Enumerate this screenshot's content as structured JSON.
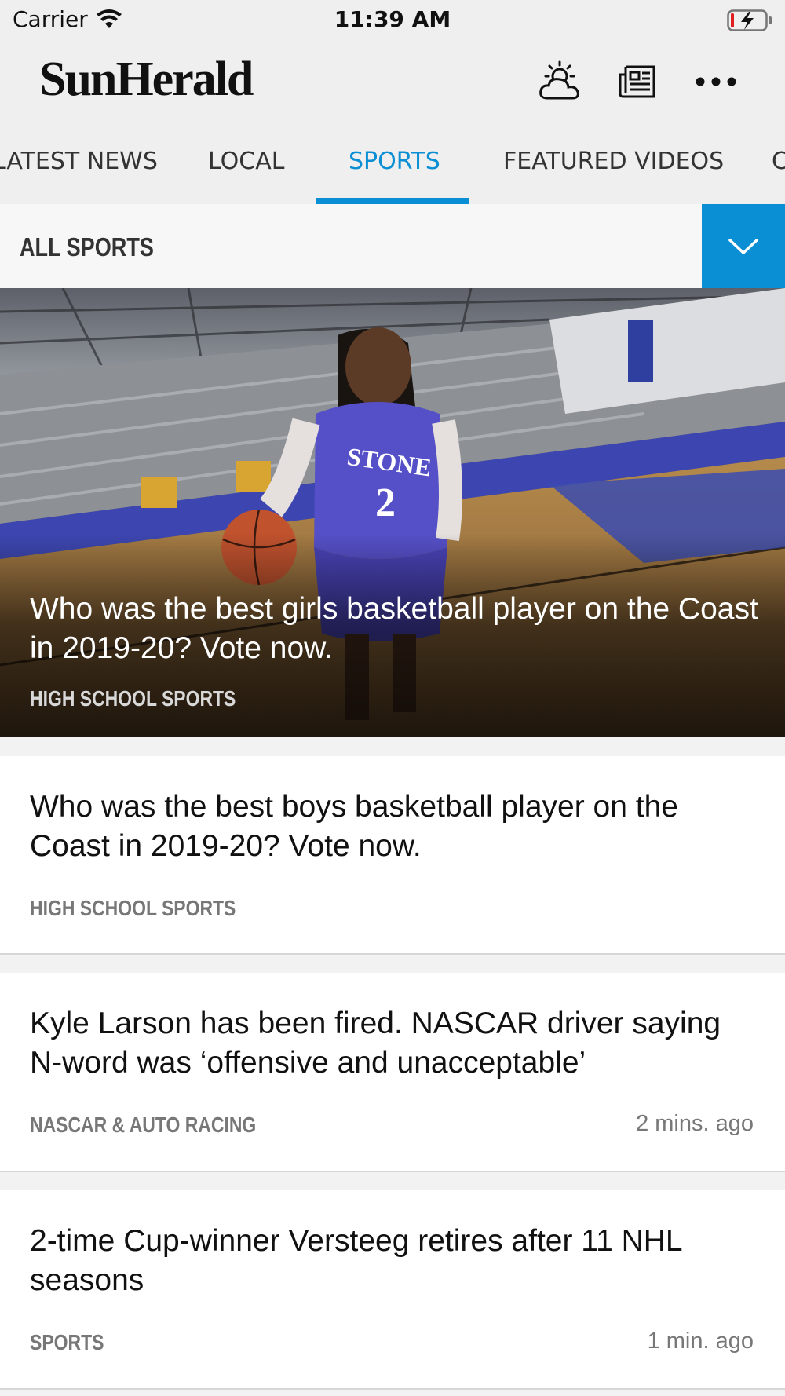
{
  "status_bar": {
    "carrier": "Carrier",
    "time": "11:39 AM"
  },
  "header": {
    "brand": "SunHeraId",
    "icons": [
      "weather-icon",
      "e-edition-icon",
      "more-icon"
    ]
  },
  "tabs": [
    {
      "label": "LATEST NEWS",
      "active": false
    },
    {
      "label": "LOCAL",
      "active": false
    },
    {
      "label": "SPORTS",
      "active": true
    },
    {
      "label": "FEATURED VIDEOS",
      "active": false
    },
    {
      "label": "C",
      "active": false
    }
  ],
  "category_bar": {
    "label": "ALL SPORTS",
    "toggle_icon": "chevron-down-icon"
  },
  "hero": {
    "title": "Who was the best girls basketball player on the Coast in 2019-20? Vote now.",
    "category": "HIGH SCHOOL SPORTS",
    "jersey_text": "STONE",
    "jersey_number": "2"
  },
  "articles": [
    {
      "title": "Who was the best boys basketball player on the Coast in 2019-20? Vote now.",
      "category": "HIGH SCHOOL SPORTS",
      "time": ""
    },
    {
      "title": "Kyle Larson has been fired. NASCAR driver saying N-word was ‘offensive and unacceptable’",
      "category": "NASCAR & AUTO RACING",
      "time": "2 mins. ago"
    },
    {
      "title": "2-time Cup-winner Versteeg retires after 11 NHL seasons",
      "category": "SPORTS",
      "time": "1 min. ago"
    }
  ],
  "colors": {
    "accent": "#0a8fd4",
    "background": "#f2f2f2"
  }
}
